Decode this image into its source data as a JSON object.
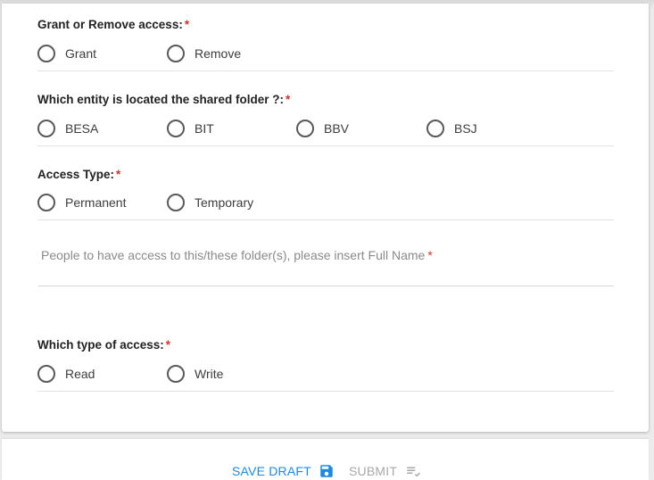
{
  "form": {
    "sections": [
      {
        "question": "Grant or Remove access:",
        "required_mark": "*",
        "options": [
          "Grant",
          "Remove"
        ]
      },
      {
        "question": "Which entity is located the shared folder ?:",
        "required_mark": "*",
        "options": [
          "BESA",
          "BIT",
          "BBV",
          "BSJ"
        ]
      },
      {
        "question": "Access Type:",
        "required_mark": "*",
        "options": [
          "Permanent",
          "Temporary"
        ]
      },
      {
        "question": "Which type of access:",
        "required_mark": "*",
        "options": [
          "Read",
          "Write"
        ]
      }
    ],
    "people_field": {
      "placeholder": "People to have access to this/these folder(s), please insert Full Name",
      "required_mark": "*",
      "value": ""
    }
  },
  "footer": {
    "save_draft_label": "SAVE DRAFT",
    "save_draft_icon": "floppy-disk-icon",
    "submit_label": "SUBMIT",
    "submit_icon": "playlist-check-icon"
  },
  "colors": {
    "accent": "#1e88e5",
    "required": "#d93025",
    "disabled": "#a8a8a8"
  }
}
